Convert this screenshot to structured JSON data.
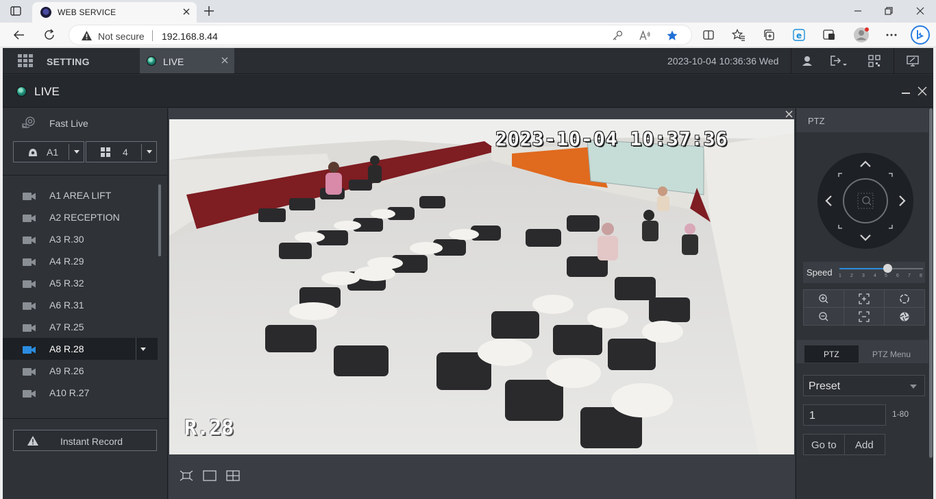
{
  "browser": {
    "tab_title": "WEB SERVICE",
    "not_secure": "Not secure",
    "url": "192.168.8.44"
  },
  "app": {
    "setting_label": "SETTING",
    "live_tab_label": "LIVE",
    "datetime": "2023-10-04 10:36:36 Wed",
    "panel_title": "LIVE"
  },
  "left": {
    "fast_live": "Fast Live",
    "area_select": "A1",
    "split_select": "4",
    "cameras": [
      {
        "label": "A1 AREA LIFT"
      },
      {
        "label": "A2 RECEPTION"
      },
      {
        "label": "A3 R.30"
      },
      {
        "label": "A4 R.29"
      },
      {
        "label": "A5 R.32"
      },
      {
        "label": "A6 R.31"
      },
      {
        "label": "A7 R.25"
      },
      {
        "label": "A8 R.28"
      },
      {
        "label": "A9 R.26"
      },
      {
        "label": "A10 R.27"
      }
    ],
    "active_index": 7,
    "instant_record": "Instant Record"
  },
  "video": {
    "osd_time": "2023-10-04 10:37:36",
    "osd_name": "R.28"
  },
  "ptz": {
    "header": "PTZ",
    "speed_label": "Speed",
    "speed_value": 5,
    "speed_ticks": [
      "1",
      "2",
      "3",
      "4",
      "5",
      "6",
      "7",
      "8"
    ],
    "tab_ptz": "PTZ",
    "tab_ptz_menu": "PTZ Menu",
    "preset_label": "Preset",
    "preset_value": "1",
    "preset_range": "1-80",
    "goto_label": "Go to",
    "add_label": "Add"
  },
  "colors": {
    "accent": "#2b8ce0",
    "panel_bg": "#2f3338",
    "header_bg": "#2a2d32"
  }
}
